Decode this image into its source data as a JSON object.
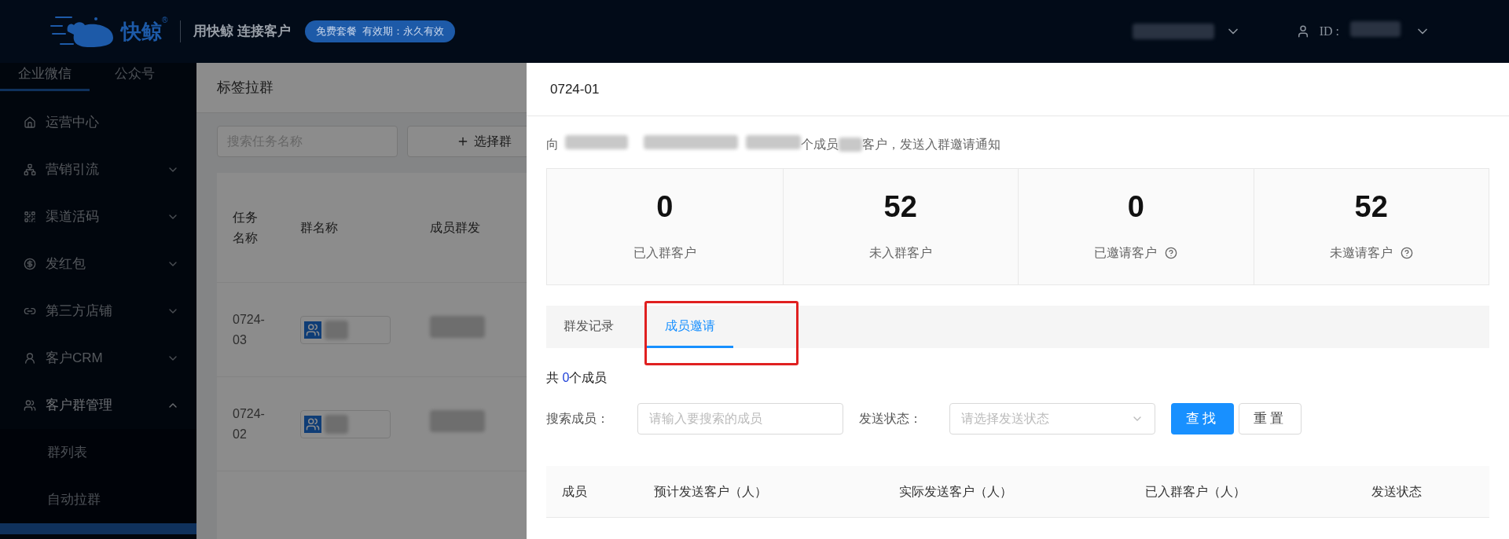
{
  "header": {
    "brand": "快鲸",
    "brand_mark": "®",
    "slogan": "用快鲸 连接客户",
    "plan_badge": "免费套餐  有效期：永久有效",
    "id_label": "ID :"
  },
  "sidebar": {
    "tabs": [
      {
        "label": "企业微信",
        "selected": true
      },
      {
        "label": "公众号",
        "selected": false
      }
    ],
    "menu": [
      {
        "label": "运营中心",
        "kind": "link",
        "expanded": false
      },
      {
        "label": "营销引流",
        "kind": "group",
        "expanded": false
      },
      {
        "label": "渠道活码",
        "kind": "group",
        "expanded": false
      },
      {
        "label": "发红包",
        "kind": "group",
        "expanded": false
      },
      {
        "label": "第三方店铺",
        "kind": "group",
        "expanded": false
      },
      {
        "label": "客户CRM",
        "kind": "group",
        "expanded": false
      },
      {
        "label": "客户群管理",
        "kind": "group",
        "expanded": true,
        "children": [
          {
            "label": "群列表"
          },
          {
            "label": "自动拉群"
          }
        ]
      }
    ]
  },
  "main": {
    "title": "标签拉群",
    "search_placeholder": "搜索任务名称",
    "add_button": "选择群",
    "columns": [
      "任务名称",
      "群名称",
      "成员群发"
    ],
    "rows": [
      {
        "task": "0724-03"
      },
      {
        "task": "0724-02"
      }
    ]
  },
  "drawer": {
    "title": "0724-01",
    "description": {
      "lead": "向",
      "mid": "个成员",
      "tail": "客户，发送入群邀请通知"
    },
    "stats": [
      {
        "value": "0",
        "label": "已入群客户",
        "help": false
      },
      {
        "value": "52",
        "label": "未入群客户",
        "help": false
      },
      {
        "value": "0",
        "label": "已邀请客户",
        "help": true
      },
      {
        "value": "52",
        "label": "未邀请客户",
        "help": true
      }
    ],
    "tabs": [
      {
        "label": "群发记录",
        "selected": false
      },
      {
        "label": "成员邀请",
        "selected": true
      }
    ],
    "count": {
      "prefix": "共 ",
      "value": "0",
      "suffix": "个成员"
    },
    "filters": {
      "member_label": "搜索成员：",
      "member_placeholder": "请输入要搜索的成员",
      "status_label": "发送状态：",
      "status_placeholder": "请选择发送状态"
    },
    "buttons": [
      {
        "label": "查找",
        "kind": "primary"
      },
      {
        "label": "重置",
        "kind": "default"
      }
    ],
    "columns": [
      "成员",
      "预计发送客户（人）",
      "实际发送客户（人）",
      "已入群客户（人）",
      "发送状态"
    ]
  }
}
